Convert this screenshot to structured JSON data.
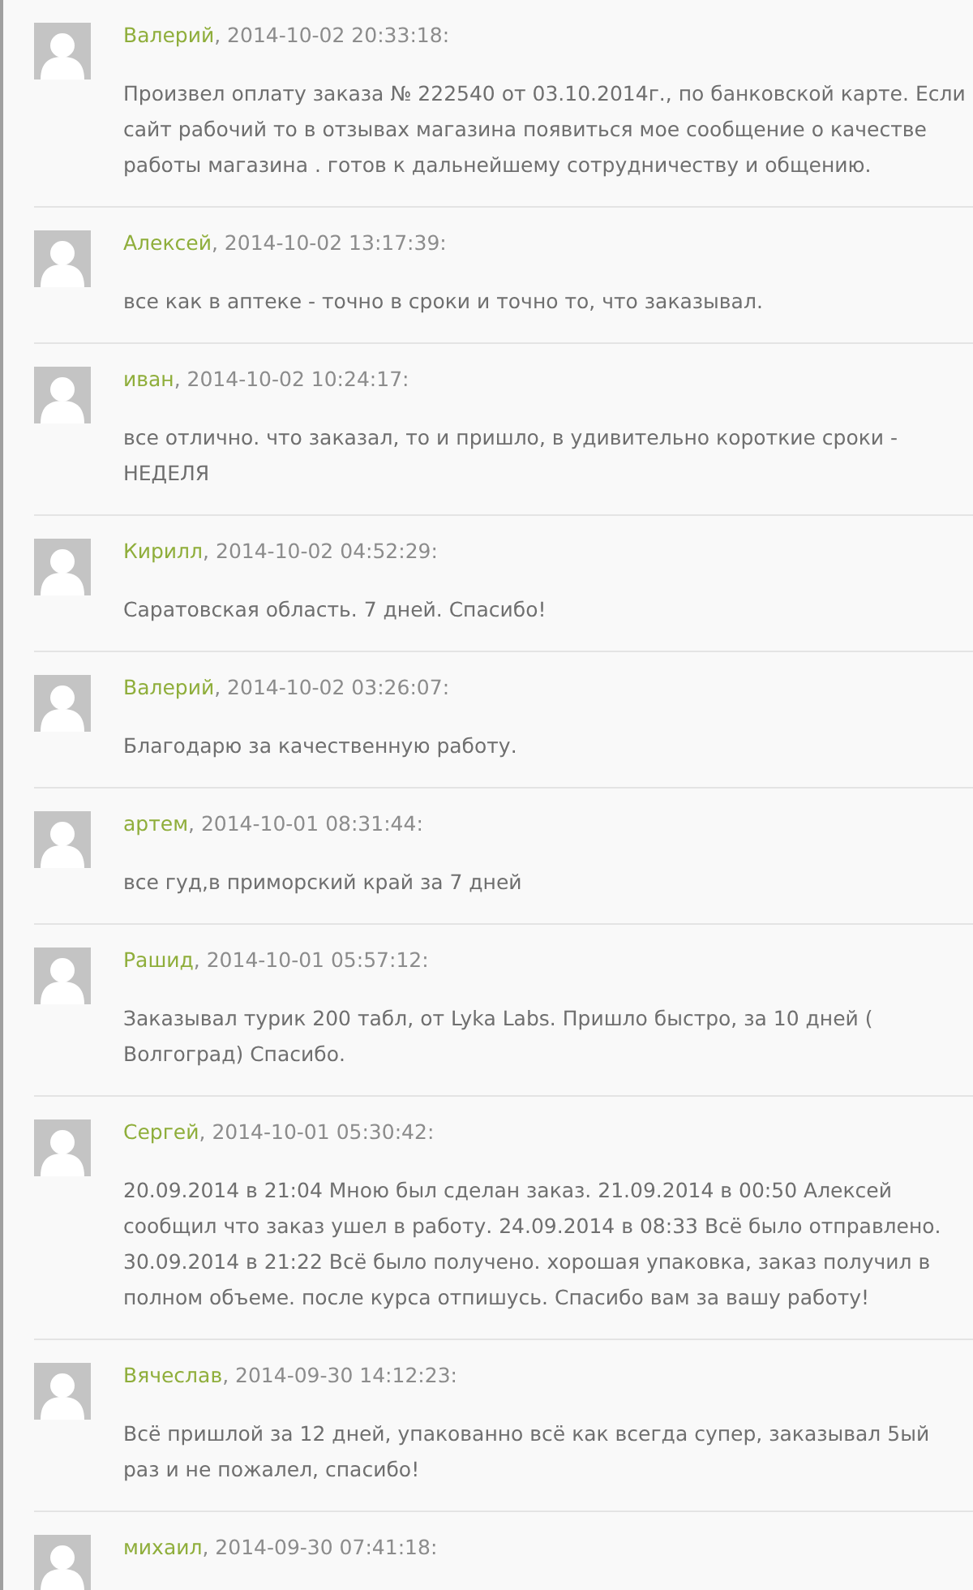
{
  "comments": [
    {
      "author": "Валерий",
      "date": ", 2014-10-02 20:33:18:",
      "text": "Произвел оплату заказа № 222540 от 03.10.2014г., по банковской карте. Если сайт рабочий то в отзывах магазина появиться мое сообщение о качестве работы магазина . готов к дальнейшему сотрудничеству и общению."
    },
    {
      "author": "Алексей",
      "date": ", 2014-10-02 13:17:39:",
      "text": "все как в аптеке - точно в сроки и точно то, что заказывал."
    },
    {
      "author": "иван",
      "date": ", 2014-10-02 10:24:17:",
      "text": "все отлично. что заказал, то и пришло, в удивительно короткие сроки - НЕДЕЛЯ"
    },
    {
      "author": "Кирилл",
      "date": ", 2014-10-02 04:52:29:",
      "text": "Саратовская область. 7 дней. Спасибо!"
    },
    {
      "author": "Валерий",
      "date": ", 2014-10-02 03:26:07:",
      "text": "Благодарю за качественную работу."
    },
    {
      "author": "артем",
      "date": ", 2014-10-01 08:31:44:",
      "text": "все гуд,в приморский край за 7 дней"
    },
    {
      "author": "Рашид",
      "date": ", 2014-10-01 05:57:12:",
      "text": "Заказывал турик 200 табл, от Lyka Labs. Пришло быстро, за 10 дней ( Волгоград) Спасибо."
    },
    {
      "author": "Сергей",
      "date": ", 2014-10-01 05:30:42:",
      "text": "20.09.2014 в 21:04 Мною был сделан заказ. 21.09.2014 в 00:50 Алексей сообщил что заказ ушел в работу. 24.09.2014 в 08:33 Всё было отправлено. 30.09.2014 в 21:22 Всё было получено. хорошая упаковка, заказ получил в полном объеме. после курса отпишусь. Спасибо вам за вашу работу!"
    },
    {
      "author": "Вячеслав",
      "date": ", 2014-09-30 14:12:23:",
      "text": "Всё пришлой за 12 дней, упакованно всё как всегда супер, заказывал 5ый раз и не пожалел, спасибо!"
    },
    {
      "author": "михаил",
      "date": ", 2014-09-30 07:41:18:"
    }
  ]
}
